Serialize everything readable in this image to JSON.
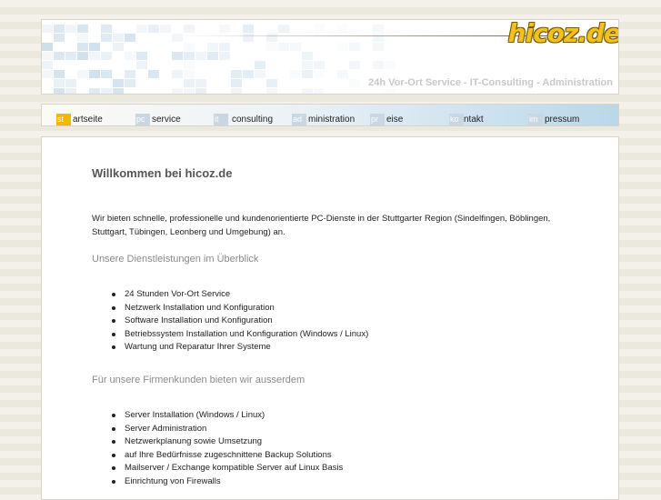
{
  "header": {
    "logo": "hicoz.de",
    "tagline": "24h Vor-Ort Service - IT-Consulting - Administration"
  },
  "nav": {
    "items": [
      {
        "abbr": "st",
        "label": "artseite",
        "active": true
      },
      {
        "abbr": "pc",
        "label": "service",
        "active": false
      },
      {
        "abbr": "it",
        "label": "consulting",
        "active": false
      },
      {
        "abbr": "ad",
        "label": "ministration",
        "active": false
      },
      {
        "abbr": "pr",
        "label": "eise",
        "active": false
      },
      {
        "abbr": "ko",
        "label": "ntakt",
        "active": false
      },
      {
        "abbr": "im",
        "label": "pressum",
        "active": false
      }
    ]
  },
  "content": {
    "title": "Willkommen bei hicoz.de",
    "intro": "Wir bieten schnelle, professionelle und kundenorientierte PC-Dienste in der Stuttgarter Region (Sindelfingen, Böblingen, Stuttgart, Tübingen, Leonberg und Umgebung) an.",
    "section1_title": "Unsere Dienstleistungen im Überblick",
    "section1_items": [
      "24 Stunden Vor-Ort Service",
      "Netzwerk Installation und Konfiguration",
      "Software Installation und Konfiguration",
      "Betriebssystem Installation und Konfiguration (Windows / Linux)",
      "Wartung und Reparatur Ihrer Systeme"
    ],
    "section2_title": "Für unsere Firmenkunden bieten wir ausserdem",
    "section2_items": [
      "Server Installation (Windows / Linux)",
      "Server Administration",
      "Netzwerkplanung sowie Umsetzung",
      "auf Ihre Bedürfnisse zugeschnittene Backup Solutions",
      "Mailserver / Exchange kompatible Server auf Linux Basis",
      "Einrichtung von Firewalls"
    ]
  },
  "colors": {
    "accent": "#f5b800",
    "nav_inactive": "#c9d7e2",
    "logo": "#f2c21b"
  }
}
